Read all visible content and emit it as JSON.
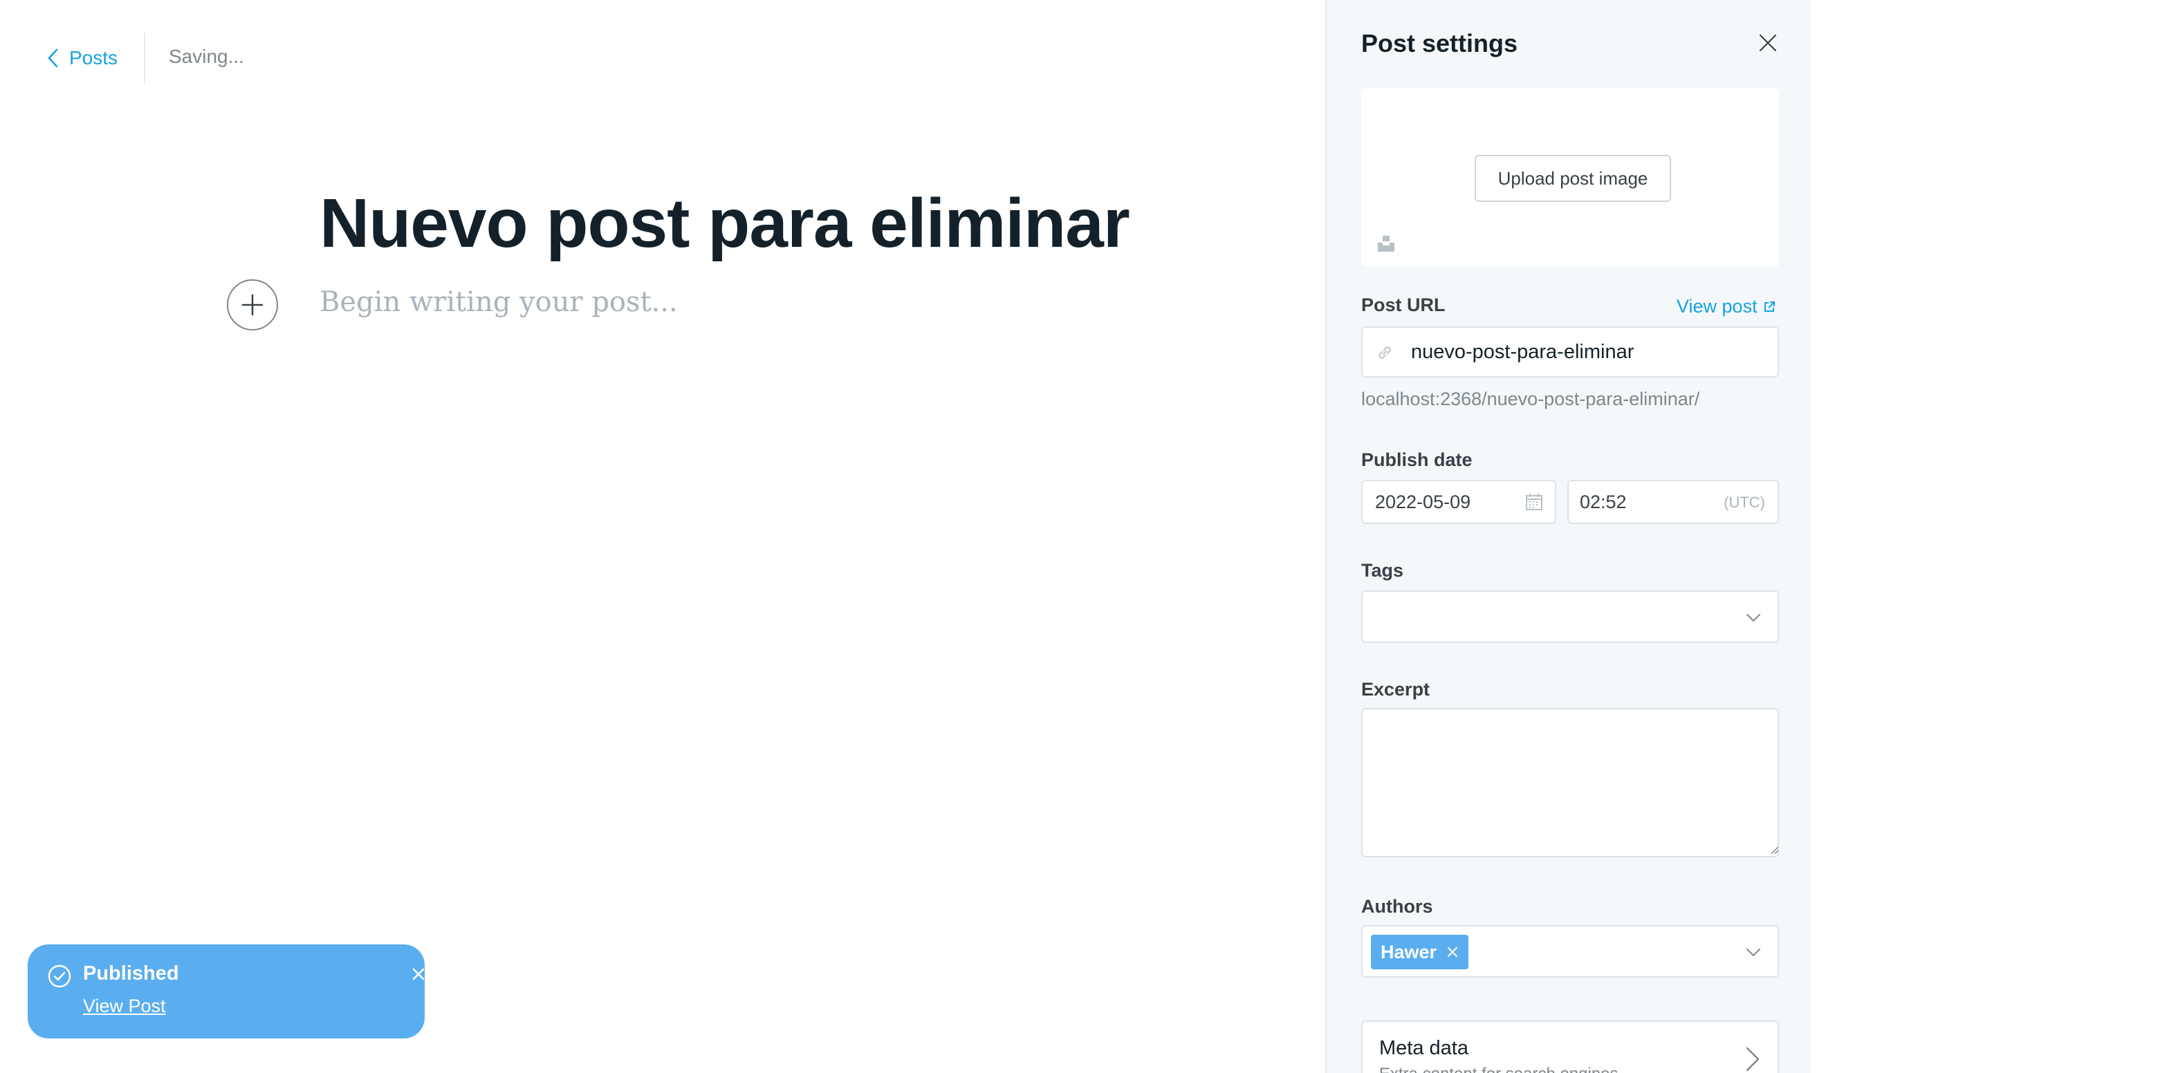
{
  "header": {
    "back_label": "Posts",
    "status": "Saving..."
  },
  "editor": {
    "title": "Nuevo post para eliminar",
    "body_placeholder": "Begin writing your post..."
  },
  "notification": {
    "title": "Published",
    "link_label": "View Post"
  },
  "settings": {
    "title": "Post settings",
    "upload_label": "Upload post image",
    "post_url": {
      "label": "Post URL",
      "view_post_label": "View post",
      "slug": "nuevo-post-para-eliminar",
      "full_url": "localhost:2368/nuevo-post-para-eliminar/"
    },
    "publish_date": {
      "label": "Publish date",
      "date": "2022-05-09",
      "time": "02:52",
      "timezone": "(UTC)"
    },
    "tags": {
      "label": "Tags"
    },
    "excerpt": {
      "label": "Excerpt",
      "value": ""
    },
    "authors": {
      "label": "Authors",
      "selected": [
        "Hawer"
      ]
    },
    "meta_data": {
      "title": "Meta data",
      "subtitle": "Extra content for search engines"
    }
  },
  "colors": {
    "accent": "#14a3e1",
    "toast": "#5aaeef",
    "panel_bg": "#f4f8fb"
  },
  "icons": {
    "back": "chevron-left-icon",
    "add_card": "plus-icon",
    "toast_status": "check-circle-icon",
    "close": "close-icon",
    "url": "link-icon",
    "calendar": "calendar-icon",
    "dropdown": "chevron-down-icon",
    "external": "external-link-icon",
    "meta": "chevron-right-icon",
    "unsplash": "unsplash-icon"
  }
}
